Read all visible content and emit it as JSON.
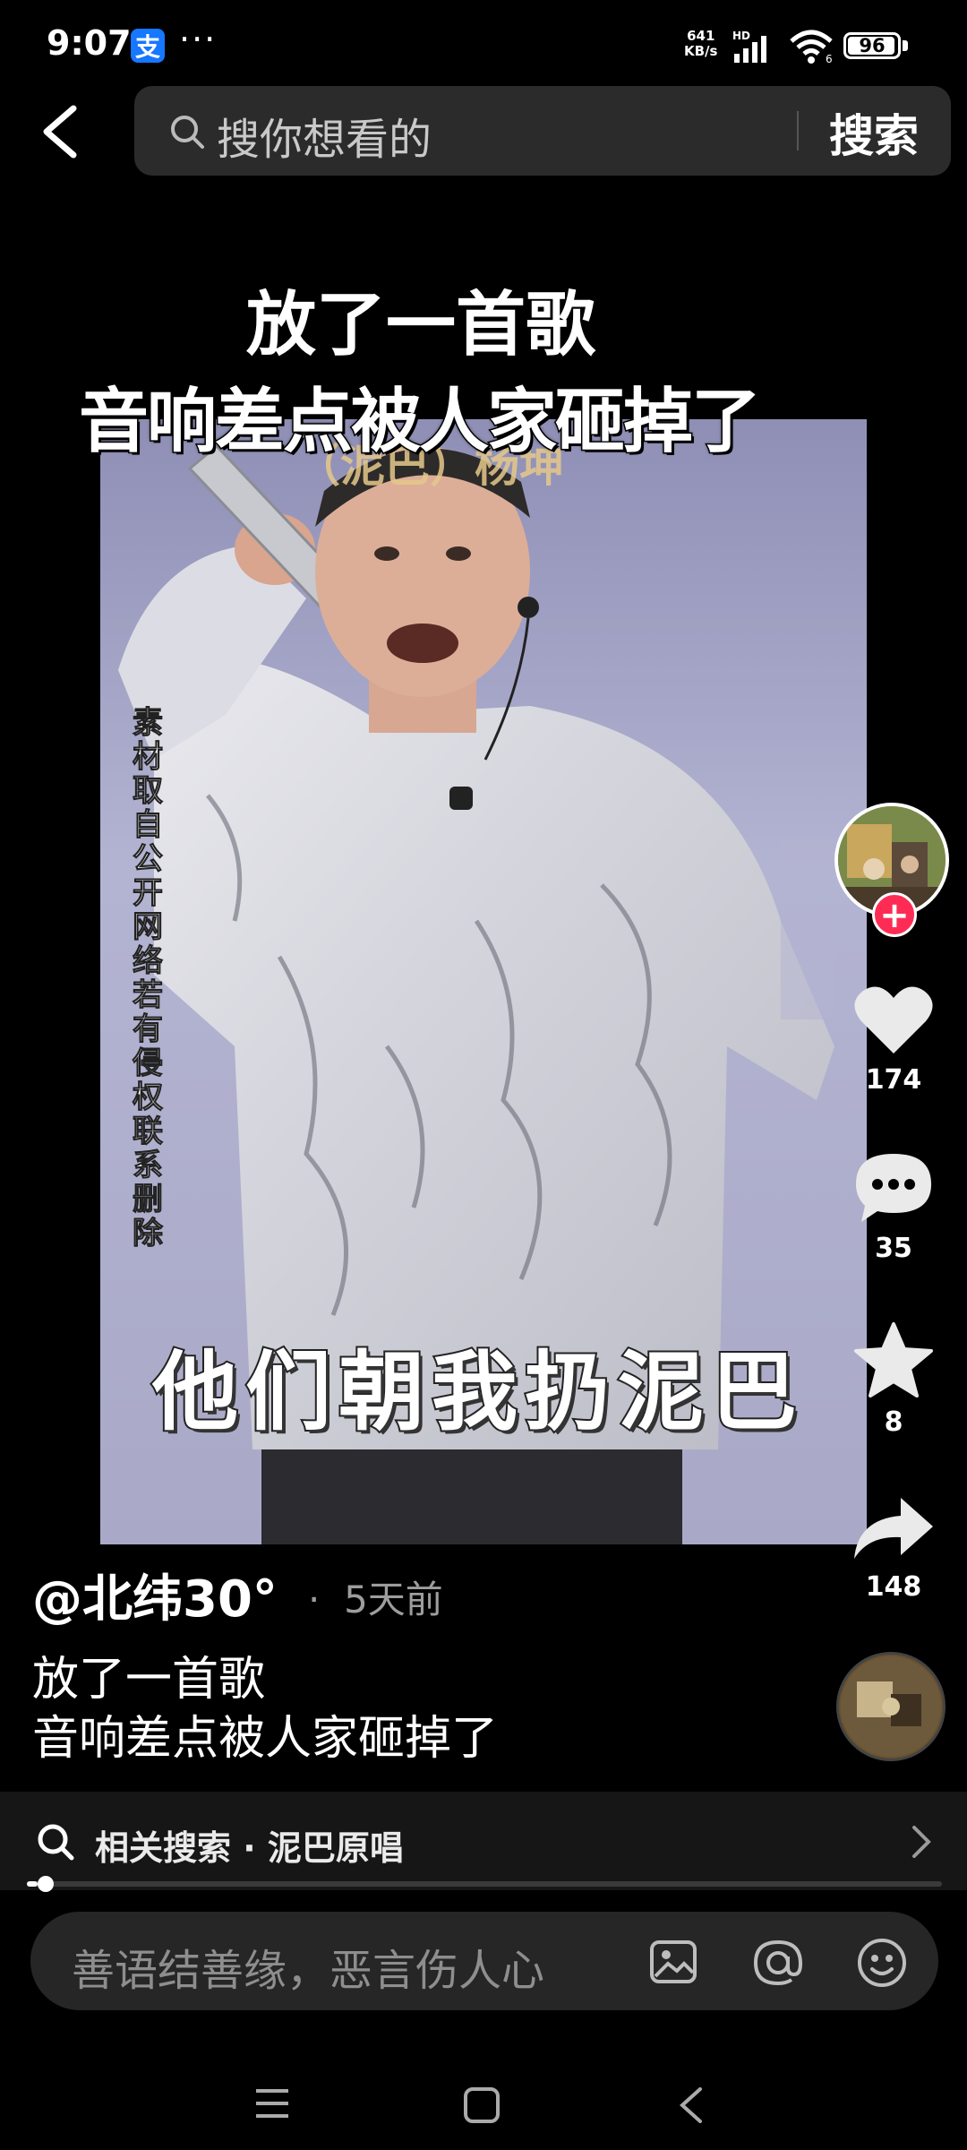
{
  "status_bar": {
    "time": "9:07",
    "alipay_glyph": "支",
    "dots": "···",
    "net_speed_value": "641",
    "net_speed_unit": "KB/s",
    "hd_label": "HD",
    "battery_level": "96",
    "icons": [
      "alipay-icon",
      "signal-icon",
      "wifi-icon",
      "battery-icon"
    ]
  },
  "search": {
    "placeholder": "搜你想看的",
    "submit_label": "搜索"
  },
  "video": {
    "title_line1": "放了一首歌",
    "title_line2": "音响差点被人家砸掉了",
    "song_credit": "（泥巴）杨坤",
    "vertical_notice": "素材取自公开网络若有侵权联系删除",
    "lyric_subtitle": "他们朝我扔泥巴"
  },
  "actions": {
    "follow_symbol": "+",
    "likes": "174",
    "comments": "35",
    "favorites": "8",
    "shares": "148"
  },
  "post": {
    "author": "@北纬30°",
    "time_sep": "·",
    "time": "5天前",
    "caption_line1": "放了一首歌",
    "caption_line2": "音响差点被人家砸掉了"
  },
  "related": {
    "text": "相关搜索 · 泥巴原唱"
  },
  "playback": {
    "progress_fraction": 0.012
  },
  "comment": {
    "placeholder": "善语结善缘，恶言伤人心"
  },
  "colors": {
    "accent": "#fe2c55",
    "background": "#000000",
    "alipay": "#1677ff"
  }
}
